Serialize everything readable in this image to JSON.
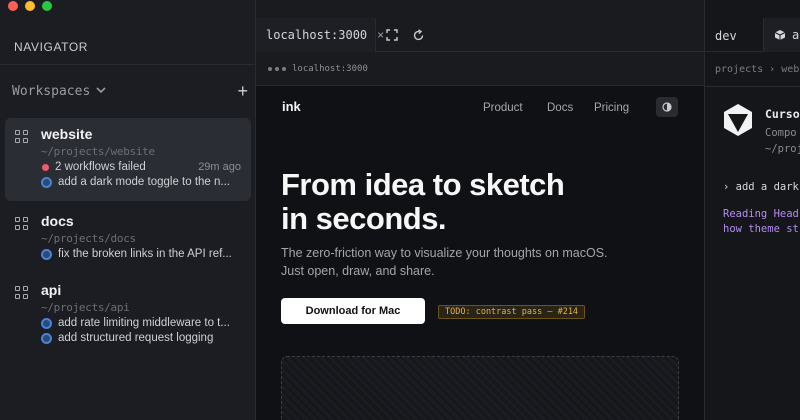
{
  "window": {
    "traffic_lights": {
      "close": "#ff5f57",
      "minimize": "#febc2e",
      "zoom": "#28c840"
    }
  },
  "sidebar": {
    "title": "NAVIGATOR",
    "workspaces_label": "Workspaces",
    "add_label": "+",
    "items": [
      {
        "name": "website",
        "path": "~/projects/website",
        "status": "2 workflows failed",
        "time": "29m ago",
        "task": "add a dark mode toggle to the n..."
      },
      {
        "name": "docs",
        "path": "~/projects/docs",
        "task": "fix the broken links in the API ref..."
      },
      {
        "name": "api",
        "path": "~/projects/api",
        "tasks": [
          "add rate limiting middleware to t...",
          "add structured request logging"
        ]
      }
    ]
  },
  "browser": {
    "tab_title": "localhost:3000",
    "tab_close": "×",
    "address": "localhost:3000"
  },
  "site": {
    "logo": "ink",
    "nav": [
      "Product",
      "Docs",
      "Pricing"
    ],
    "hero_title_line1": "From idea to sketch",
    "hero_title_line2": "in seconds.",
    "hero_sub_line1": "The zero-friction way to visualize your thoughts on macOS.",
    "hero_sub_line2": "Just open, draw, and share.",
    "download_label": "Download for Mac",
    "todo_label": "TODO: contrast pass — #214"
  },
  "right_panel": {
    "tab_dev": "dev",
    "tab_agent": "ag",
    "breadcrumb": "projects › web",
    "agent_name": "Curso",
    "agent_desc_line1": "Compo",
    "agent_desc_line2": "~/proj",
    "command": "› add a dark",
    "output_line1": "Reading Head",
    "output_line2": "how theme st"
  },
  "colors": {
    "accent_blue": "#4a82d8",
    "error_red": "#ef5a6f",
    "todo_amber": "#e0b24a",
    "agent_purple": "#b48bf0"
  }
}
